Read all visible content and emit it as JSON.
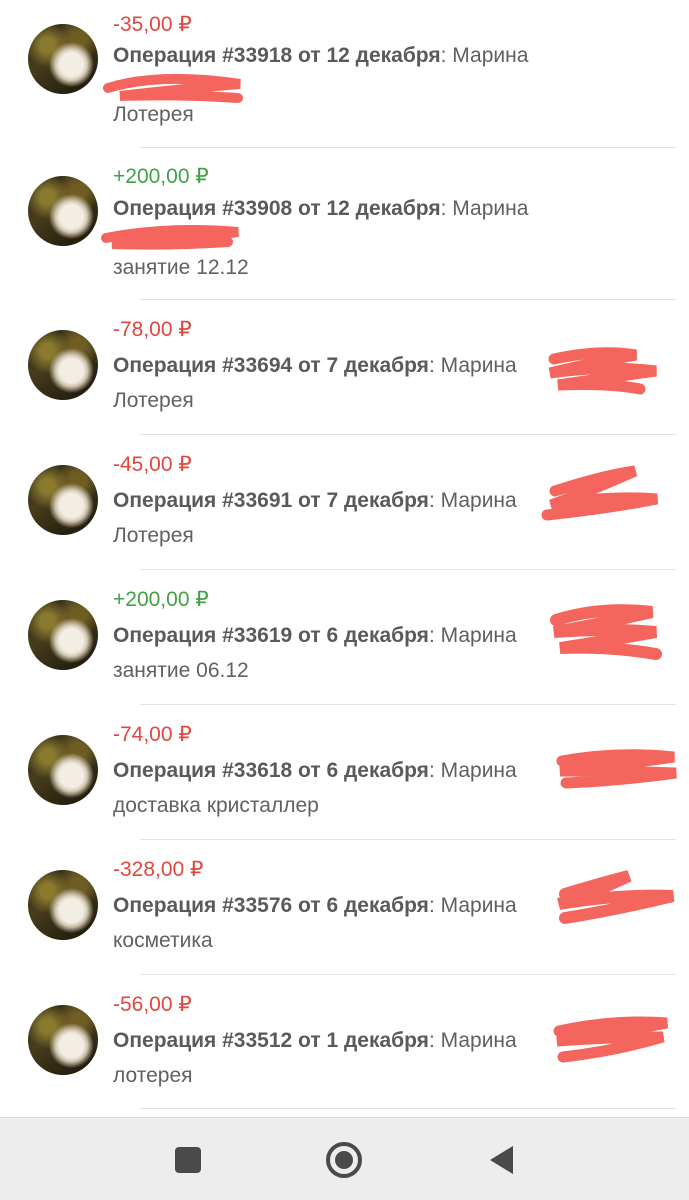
{
  "currency": "₽",
  "colors": {
    "negative": "#e0473f",
    "positive": "#43a047",
    "redaction": "#f4665d"
  },
  "transactions": [
    {
      "amount": "-35,00 ₽",
      "sign": "neg",
      "op_label": "Операция #33918 от 12 декабря",
      "payer": ": Марина",
      "comment": "Лотерея"
    },
    {
      "amount": "+200,00 ₽",
      "sign": "pos",
      "op_label": "Операция #33908 от 12 декабря",
      "payer": ": Марина",
      "comment": "занятие 12.12"
    },
    {
      "amount": "-78,00 ₽",
      "sign": "neg",
      "op_label": "Операция #33694 от 7 декабря",
      "payer": ": Марина",
      "comment": "Лотерея"
    },
    {
      "amount": "-45,00 ₽",
      "sign": "neg",
      "op_label": "Операция #33691 от 7 декабря",
      "payer": ": Марина",
      "comment": "Лотерея"
    },
    {
      "amount": "+200,00 ₽",
      "sign": "pos",
      "op_label": "Операция #33619 от 6 декабря",
      "payer": ": Марина",
      "comment": "занятие 06.12"
    },
    {
      "amount": "-74,00 ₽",
      "sign": "neg",
      "op_label": "Операция #33618 от 6 декабря",
      "payer": ": Марина",
      "comment": "доставка кристаллер"
    },
    {
      "amount": "-328,00 ₽",
      "sign": "neg",
      "op_label": "Операция #33576 от 6 декабря",
      "payer": ": Марина",
      "comment": "косметика"
    },
    {
      "amount": "-56,00 ₽",
      "sign": "neg",
      "op_label": "Операция #33512 от 1 декабря",
      "payer": ": Марина",
      "comment": "лотерея"
    }
  ],
  "nav": {
    "recents_icon": "square-icon",
    "home_icon": "circle-home-icon",
    "back_icon": "triangle-back-icon"
  }
}
